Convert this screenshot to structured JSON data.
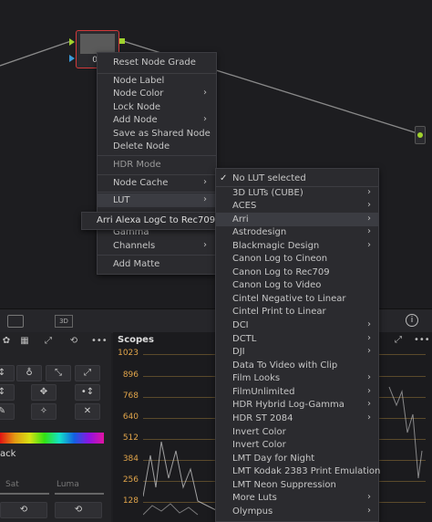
{
  "node": {
    "label": "01"
  },
  "context_menu": {
    "items": [
      {
        "label": "Reset Node Grade"
      },
      {
        "label": "Node Label"
      },
      {
        "label": "Node Color"
      },
      {
        "label": "Lock Node"
      },
      {
        "label": "Add Node"
      },
      {
        "label": "Save as Shared Node"
      },
      {
        "label": "Delete Node"
      },
      {
        "label": "HDR Mode"
      },
      {
        "label": "Node Cache"
      },
      {
        "label": "LUT"
      },
      {
        "label": "Gamma"
      },
      {
        "label": "Channels"
      },
      {
        "label": "Add Matte"
      }
    ]
  },
  "recent_lut": {
    "label": "Arri Alexa LogC to Rec709"
  },
  "lut_menu": {
    "items": [
      {
        "label": "No LUT selected"
      },
      {
        "label": "3D LUTs (CUBE)"
      },
      {
        "label": "ACES"
      },
      {
        "label": "Arri"
      },
      {
        "label": "Astrodesign"
      },
      {
        "label": "Blackmagic Design"
      },
      {
        "label": "Canon Log to Cineon"
      },
      {
        "label": "Canon Log to Rec709"
      },
      {
        "label": "Canon Log to Video"
      },
      {
        "label": "Cintel Negative to Linear"
      },
      {
        "label": "Cintel Print to Linear"
      },
      {
        "label": "DCI"
      },
      {
        "label": "DCTL"
      },
      {
        "label": "DJI"
      },
      {
        "label": "Data To Video with Clip"
      },
      {
        "label": "Film Looks"
      },
      {
        "label": "FilmUnlimited"
      },
      {
        "label": "HDR Hybrid Log-Gamma"
      },
      {
        "label": "HDR ST 2084"
      },
      {
        "label": "Invert Color"
      },
      {
        "label": "Invert Color"
      },
      {
        "label": "LMT Day for Night"
      },
      {
        "label": "LMT Kodak 2383 Print Emulation"
      },
      {
        "label": "LMT Neon Suppression"
      },
      {
        "label": "More Luts"
      },
      {
        "label": "Olympus"
      }
    ]
  },
  "toolbar": {
    "badge_3d": "3D"
  },
  "scopes": {
    "title": "Scopes",
    "ticks": [
      "1023",
      "896",
      "768",
      "640",
      "512",
      "384",
      "256",
      "128"
    ]
  },
  "left_panel": {
    "label_track": "ack",
    "label_sat": "Sat",
    "label_luma": "Luma"
  },
  "colors": {
    "accent": "#e0a44a",
    "node_border": "#d23a3a",
    "connector": "#a0d22e"
  }
}
